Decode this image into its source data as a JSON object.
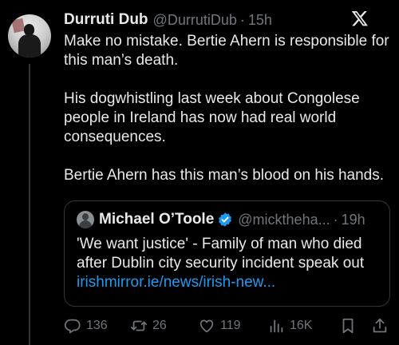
{
  "post": {
    "author_name": "Durruti Dub",
    "author_handle": "@DurrutiDub",
    "separator": "·",
    "time": "15h",
    "paragraphs": [
      "Make no mistake. Bertie Ahern is responsible for this man’s death.",
      "His dogwhistling last week about Congolese people in Ireland has now had real world consequences.",
      "Bertie Ahern has this man’s blood on his hands."
    ]
  },
  "quote": {
    "author_name": "Michael O’Toole",
    "author_handle": "@micktheha...",
    "separator": "·",
    "time": "19h",
    "text": "'We want justice' - Family of man who died after Dublin city security incident speak out",
    "link": "irishmirror.ie/news/irish-new..."
  },
  "actions": {
    "replies": "136",
    "reposts": "26",
    "likes": "119",
    "views": "16K"
  },
  "icons": {
    "logo": "x-logo-icon",
    "verified": "verified-badge-icon",
    "reply": "reply-icon",
    "repost": "repost-icon",
    "like": "heart-icon",
    "views": "views-icon",
    "bookmark": "bookmark-icon",
    "share": "share-icon"
  },
  "colors": {
    "background": "#000000",
    "text": "#e7e9ea",
    "secondary": "#71767b",
    "link": "#1d9bf0"
  }
}
